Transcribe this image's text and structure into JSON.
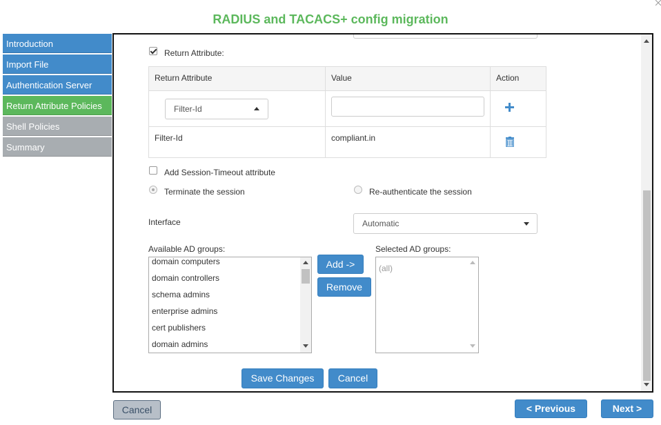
{
  "dialog": {
    "title": "RADIUS and TACACS+ config migration"
  },
  "sidebar": {
    "items": [
      {
        "label": "Introduction",
        "state": "done"
      },
      {
        "label": "Import File",
        "state": "done"
      },
      {
        "label": "Authentication Server",
        "state": "done"
      },
      {
        "label": "Return Attribute Policies",
        "state": "active"
      },
      {
        "label": "Shell Policies",
        "state": "pending"
      },
      {
        "label": "Summary",
        "state": "pending"
      }
    ]
  },
  "form": {
    "return_attribute": {
      "label": "Return Attribute:",
      "checked": true
    },
    "table": {
      "headers": [
        "Return Attribute",
        "Value",
        "Action"
      ],
      "new_row": {
        "attribute_select": "Filter-Id",
        "value": ""
      },
      "rows": [
        {
          "attribute": "Filter-Id",
          "value": "compliant.in"
        }
      ]
    },
    "session_timeout": {
      "label": "Add Session-Timeout attribute",
      "checked": false
    },
    "session_options": {
      "terminate": {
        "label": "Terminate the session",
        "selected": true
      },
      "reauthenticate": {
        "label": "Re-authenticate the session",
        "selected": false
      }
    },
    "interface": {
      "label": "Interface",
      "value": "Automatic"
    },
    "available_groups": {
      "label": "Available AD groups:",
      "items": [
        "domain computers",
        "domain controllers",
        "schema admins",
        "enterprise admins",
        "cert publishers",
        "domain admins"
      ]
    },
    "selected_groups": {
      "label": "Selected AD groups:",
      "items": [
        "(all)"
      ]
    },
    "buttons": {
      "add": "Add ->",
      "remove": "Remove",
      "save": "Save Changes",
      "cancel": "Cancel"
    }
  },
  "footer": {
    "cancel": "Cancel",
    "previous": "< Previous",
    "next": "Next >"
  },
  "colors": {
    "title_green": "#5cb85c",
    "primary_blue": "#428bca",
    "pending_grey": "#a8adb1"
  }
}
